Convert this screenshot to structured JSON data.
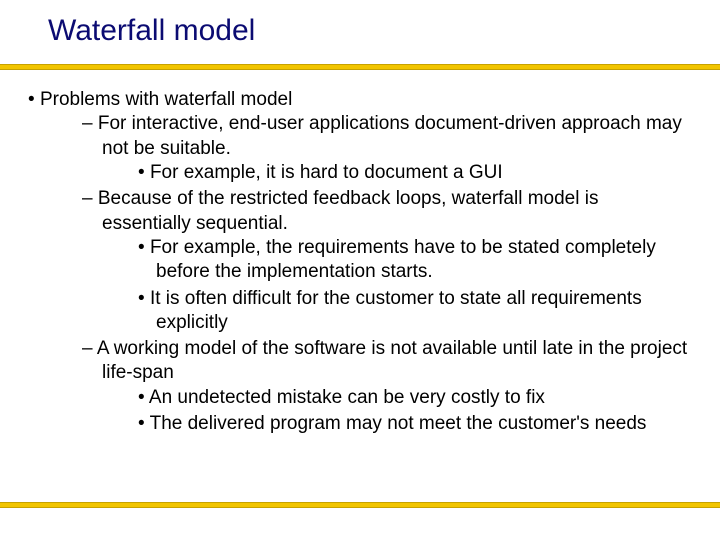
{
  "title": "Waterfall model",
  "bullets": {
    "l0_0": "Problems with waterfall model",
    "l1_0": "For interactive, end-user applications document-driven approach may not be suitable.",
    "l2_0": "For example, it is hard to document a GUI",
    "l1_1": "Because of the restricted feedback loops, waterfall model is essentially sequential.",
    "l2_1": "For example, the requirements have to be stated completely before the implementation starts.",
    "l2_2": "It is often difficult for the customer to state all requirements explicitly",
    "l1_2": "A working model of the software is not available until late in the project life-span",
    "l2_3": "An undetected mistake can be very costly to fix",
    "l2_4": "The delivered program may not meet the customer's needs"
  }
}
